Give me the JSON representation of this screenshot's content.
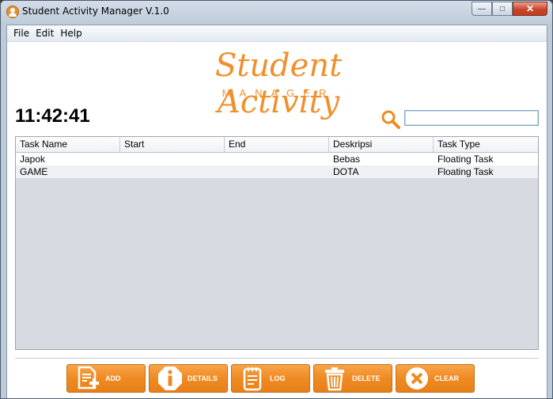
{
  "window": {
    "title": "Student Activity Manager V.1.0"
  },
  "menu": [
    "File",
    "Edit",
    "Help"
  ],
  "logo": {
    "main": "Student Activity",
    "sub": "MANAGER"
  },
  "clock": "11:42:41",
  "search": {
    "value": "",
    "placeholder": ""
  },
  "table": {
    "columns": [
      "Task Name",
      "Start",
      "End",
      "Deskripsi",
      "Task Type"
    ],
    "rows": [
      [
        "Japok",
        "",
        "",
        "Bebas",
        "Floating Task"
      ],
      [
        "GAME",
        "",
        "",
        "DOTA",
        "Floating Task"
      ]
    ]
  },
  "buttons": [
    {
      "label": "ADD",
      "icon": "add-document-icon"
    },
    {
      "label": "DETAILS",
      "icon": "info-icon"
    },
    {
      "label": "LOG",
      "icon": "notepad-icon"
    },
    {
      "label": "DELETE",
      "icon": "trash-icon"
    },
    {
      "label": "CLEAR",
      "icon": "clear-x-icon"
    }
  ],
  "colors": {
    "accent": "#f0902c",
    "title_bar": "#bdcbd9"
  }
}
